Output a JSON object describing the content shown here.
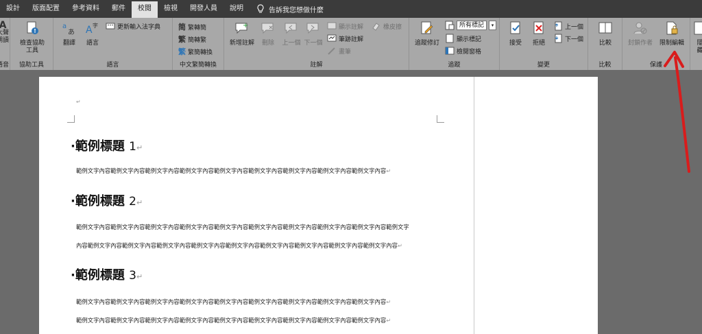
{
  "tabs": [
    "設計",
    "版面配置",
    "參考資料",
    "郵件",
    "校閱",
    "檢視",
    "開發人員",
    "說明"
  ],
  "active_tab": "校閱",
  "tell_me": "告訴我您想做什麼",
  "ribbon": {
    "partial_left": {
      "label1": "大聲",
      "label2": "朗讀",
      "group": "語音"
    },
    "accessibility": {
      "check_label": "檢查協助",
      "check_label2": "工具",
      "group": "協助工具"
    },
    "language": {
      "translate": "翻譯",
      "language": "語言",
      "update_ime": "更新輸入法字典",
      "group": "語言"
    },
    "chinese": {
      "to_trad": "繁轉簡",
      "to_simp": "簡轉繁",
      "convert": "繁簡轉換",
      "group": "中文繁簡轉換"
    },
    "comments": {
      "new": "新增註解",
      "delete": "刪除",
      "prev": "上一個",
      "next": "下一個",
      "show": "顯示註解",
      "ink": "筆跡註解",
      "eraser": "橡皮擦",
      "pen": "畫筆",
      "group": "註解"
    },
    "tracking": {
      "track": "追蹤修訂",
      "markup_select": "所有標記",
      "show_markup": "顯示標記",
      "review_pane": "檢閱窗格",
      "group": "追蹤"
    },
    "changes": {
      "accept": "接受",
      "reject": "拒絕",
      "prev": "上一個",
      "next": "下一個",
      "group": "變更"
    },
    "compare": {
      "compare": "比較",
      "group": "比較"
    },
    "protect": {
      "block_authors": "封鎖作者",
      "restrict_editing": "限制編輯",
      "group": "保護"
    },
    "partial_right": {
      "label1": "隱",
      "label2": "藏"
    }
  },
  "document": {
    "headings": [
      {
        "bullet": "·",
        "text": "範例標題 ",
        "num": "1"
      },
      {
        "bullet": "·",
        "text": "範例標題 ",
        "num": "2"
      },
      {
        "bullet": "·",
        "text": "範例標題 ",
        "num": "3"
      }
    ],
    "paragraphs": [
      "範例文字內容範例文字內容範例文字內容範例文字內容範例文字內容範例文字內容範例文字內容範例文字內容範例文字內容",
      "範例文字內容範例文字內容範例文字內容範例文字內容範例文字內容範例文字內容範例文字內容範例文字內容範例文字內容範例文字",
      "內容範例文字內容範例文字內容範例文字內容範例文字內容範例文字內容範例文字內容範例文字內容範例文字內容範例文字內容",
      "範例文字內容範例文字內容範例文字內容範例文字內容範例文字內容範例文字內容範例文字內容範例文字內容範例文字內容",
      "範例文字內容範例文字內容範例文字內容範例文字內容範例文字內容範例文字內容範例文字內容範例文字內容範例文字內容"
    ],
    "para_mark": "↵",
    "accent_arrow_color": "#d91c1c"
  }
}
